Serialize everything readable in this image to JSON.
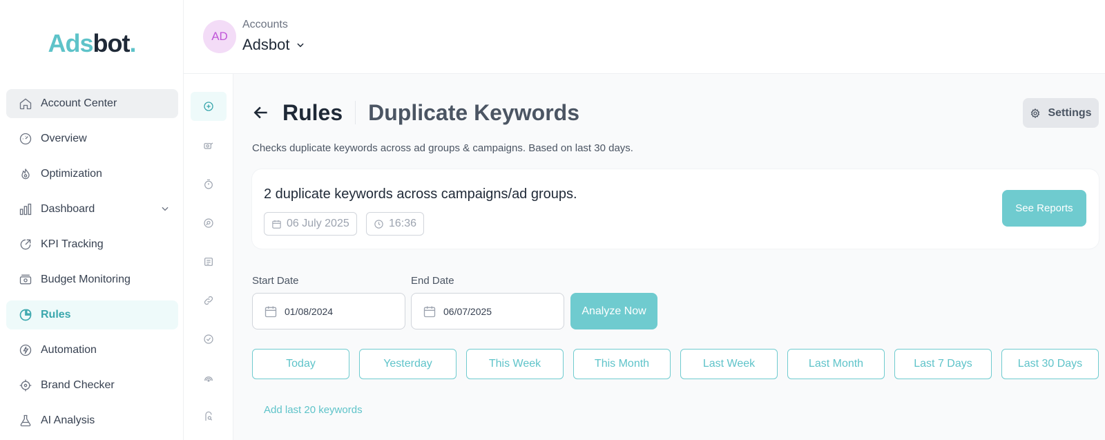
{
  "brand": {
    "part1": "Ads",
    "part2": "bot",
    "dot": ".",
    "accent": "#5ec3c9"
  },
  "sidebar": {
    "items": [
      {
        "label": "Account Center",
        "icon": "home-icon"
      },
      {
        "label": "Overview",
        "icon": "gauge-icon"
      },
      {
        "label": "Optimization",
        "icon": "flame-icon"
      },
      {
        "label": "Dashboard",
        "icon": "bar-chart-icon",
        "expandable": true
      },
      {
        "label": "KPI Tracking",
        "icon": "trend-icon"
      },
      {
        "label": "Budget Monitoring",
        "icon": "money-icon"
      },
      {
        "label": "Rules",
        "icon": "pie-chart-icon",
        "active": true
      },
      {
        "label": "Automation",
        "icon": "bolt-icon"
      },
      {
        "label": "Brand Checker",
        "icon": "crosshair-icon"
      },
      {
        "label": "AI Analysis",
        "icon": "flask-icon"
      }
    ]
  },
  "header": {
    "account_initials": "AD",
    "account_label": "Accounts",
    "account_name": "Adsbot"
  },
  "rail": {
    "icons": [
      "plus-circle-icon",
      "camera-icon",
      "timer-icon",
      "search-circle-icon",
      "document-icon",
      "link-icon",
      "check-circle-icon",
      "signal-icon",
      "user-search-icon"
    ]
  },
  "page": {
    "title": "Rules",
    "subtitle": "Duplicate Keywords",
    "settings_label": "Settings",
    "description": "Checks duplicate keywords across ad groups & campaigns. Based on last 30 days."
  },
  "summary": {
    "text": "2 duplicate keywords across campaigns/ad groups.",
    "date": "06 July 2025",
    "time": "16:36",
    "button": "See Reports"
  },
  "filters": {
    "start_label": "Start Date",
    "start_value": "01/08/2024",
    "end_label": "End Date",
    "end_value": "06/07/2025",
    "analyze": "Analyze Now",
    "presets": [
      "Today",
      "Yesterday",
      "This Week",
      "This Month",
      "Last Week",
      "Last Month",
      "Last 7 Days",
      "Last 30 Days"
    ]
  },
  "add_link": "Add last 20 keywords"
}
